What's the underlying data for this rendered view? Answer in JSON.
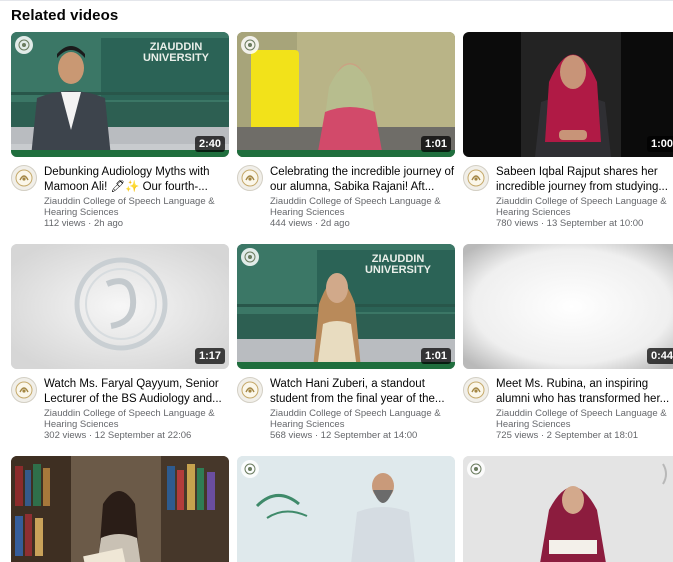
{
  "section_title": "Related videos",
  "videos": [
    {
      "title": "Debunking Audiology Myths with Mamoon Ali! 🖊✨ Our fourth-...",
      "channel": "Ziauddin College of Speech Language & Hearing Sciences",
      "stats": "112 views · 2h ago",
      "duration": "2:40",
      "banner": "ZIAUDDIN UNIVERSITY"
    },
    {
      "title": "Celebrating the incredible journey of our alumna, Sabika Rajani! Aft...",
      "channel": "Ziauddin College of Speech Language & Hearing Sciences",
      "stats": "444 views · 2d ago",
      "duration": "1:01"
    },
    {
      "title": "Sabeen Iqbal Rajput shares her incredible journey from studying...",
      "channel": "Ziauddin College of Speech Language & Hearing Sciences",
      "stats": "780 views · 13 September at 10:00",
      "duration": "1:00"
    },
    {
      "title": "Watch Ms. Faryal Qayyum, Senior Lecturer of the BS Audiology and...",
      "channel": "Ziauddin College of Speech Language & Hearing Sciences",
      "stats": "302 views · 12 September at 22:06",
      "duration": "1:17"
    },
    {
      "title": "Watch Hani Zuberi, a standout student from the final year of the...",
      "channel": "Ziauddin College of Speech Language & Hearing Sciences",
      "stats": "568 views · 12 September at 14:00",
      "duration": "1:01",
      "banner": "ZIAUDDIN UNIVERSITY"
    },
    {
      "title": "Meet Ms. Rubina, an inspiring alumni who has transformed her...",
      "channel": "Ziauddin College of Speech Language & Hearing Sciences",
      "stats": "725 views · 2 September at 18:01",
      "duration": "0:44"
    }
  ]
}
